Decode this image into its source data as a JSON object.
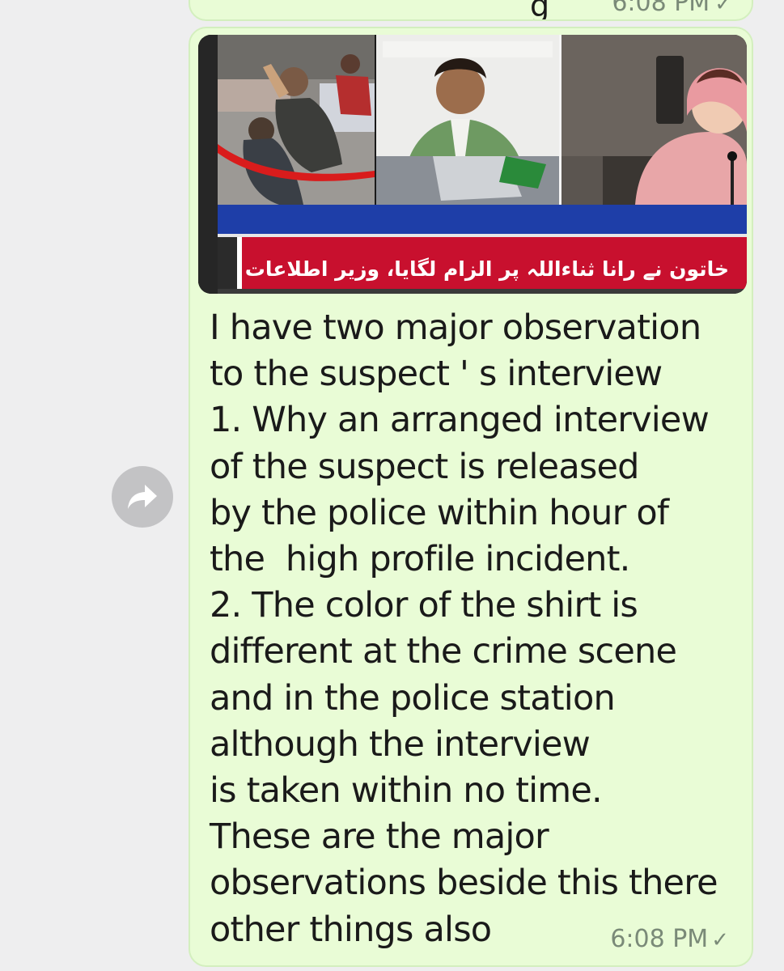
{
  "previous_message": {
    "text_fragment": "g",
    "time": "6:08 PM",
    "status_icon": "check-icon"
  },
  "message": {
    "media": {
      "description_icon": "news-screenshot-image",
      "ticker_text": "خاتون نے رانا ثناءاللہ پر الزام لگایا، وزیر اطلاعات"
    },
    "text": "I have two major observation\nto the suspect ' s interview\n1. Why an arranged interview\nof the suspect is released\nby the police within hour of\nthe  high profile incident.\n2. The color of the shirt is\ndifferent at the crime scene\nand in the police station\nalthough the interview\nis taken within no time.\nThese are the major\nobservations beside this there\nother things also",
    "time": "6:08 PM",
    "status_icon": "check-icon"
  },
  "actions": {
    "forward_icon": "forward-icon"
  },
  "colors": {
    "background": "#eeeeef",
    "bubble": "#e9fcd6",
    "bubble_border": "#d3efbe",
    "timestamp": "#7a8a78",
    "forward_button": "#c3c3c5",
    "ticker_red": "#c8102e",
    "ticker_blue": "#1e3ea8"
  }
}
